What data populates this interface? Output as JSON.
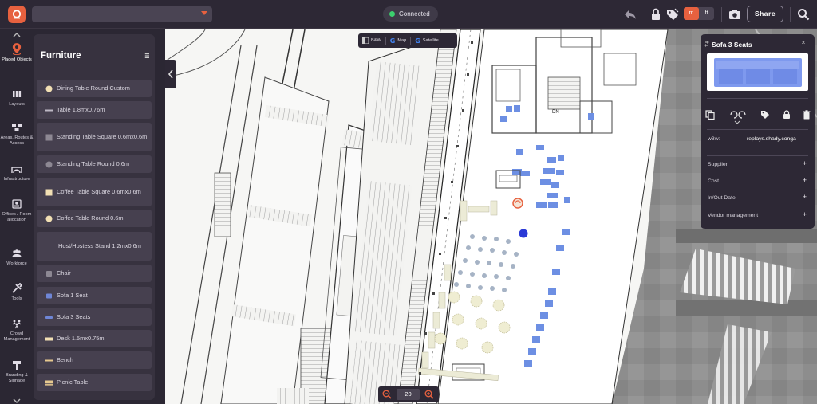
{
  "app": {
    "brand_color": "#e7613f",
    "connection": "Connected",
    "units": {
      "metric": "m",
      "imperial": "ft",
      "active": "m"
    },
    "share_label": "Share"
  },
  "rail": {
    "items": [
      {
        "label": "Placed Objects",
        "icon": "map-pin-icon",
        "active": true
      },
      {
        "label": "Layouts",
        "icon": "columns-icon"
      },
      {
        "label": "Areas, Routes & Access",
        "icon": "routes-icon"
      },
      {
        "label": "Infrastructure",
        "icon": "bridge-icon"
      },
      {
        "label": "Offices / Room allocation",
        "icon": "office-icon"
      },
      {
        "label": "Workforce",
        "icon": "people-icon"
      },
      {
        "label": "Tools",
        "icon": "tools-icon"
      },
      {
        "label": "Crowd Management",
        "icon": "crowd-icon"
      },
      {
        "label": "Branding & Signage",
        "icon": "sign-icon"
      }
    ]
  },
  "panel": {
    "title": "Furniture",
    "items": [
      {
        "label": "Dining Table Round Custom",
        "icon": "round-table-icon"
      },
      {
        "label": "Table 1.8mx0.76m",
        "icon": "rect-table-icon"
      },
      {
        "label": "Standing Table Square 0.6mx0.6m",
        "icon": "square-table-icon"
      },
      {
        "label": "Standing Table Round 0.6m",
        "icon": "round-table-icon"
      },
      {
        "label": "Coffee Table Square 0.6mx0.6m",
        "icon": "square-table-icon"
      },
      {
        "label": "Coffee Table Round 0.6m",
        "icon": "round-table-icon"
      },
      {
        "label": "Host/Hostess Stand 1.2mx0.6m",
        "icon": "stand-icon"
      },
      {
        "label": "Chair",
        "icon": "chair-icon"
      },
      {
        "label": "Sofa 1 Seat",
        "icon": "sofa-icon"
      },
      {
        "label": "Sofa 3 Seats",
        "icon": "sofa-icon"
      },
      {
        "label": "Desk 1.5mx0.75m",
        "icon": "desk-icon"
      },
      {
        "label": "Bench",
        "icon": "bench-icon"
      },
      {
        "label": "Picnic Table",
        "icon": "picnic-icon"
      }
    ]
  },
  "map": {
    "types": [
      {
        "label": "B&W",
        "icon": "bw-icon"
      },
      {
        "label": "Map",
        "icon": "google-icon"
      },
      {
        "label": "Satellite",
        "icon": "google-icon"
      }
    ],
    "zoom": "20"
  },
  "properties": {
    "title": "Sofa 3 Seats",
    "w3w_label": "w3w:",
    "w3w_value": "replays.shady.conga",
    "rows": [
      {
        "label": "Supplier"
      },
      {
        "label": "Cost"
      },
      {
        "label": "In/Out Date"
      },
      {
        "label": "Vendor management"
      }
    ]
  }
}
